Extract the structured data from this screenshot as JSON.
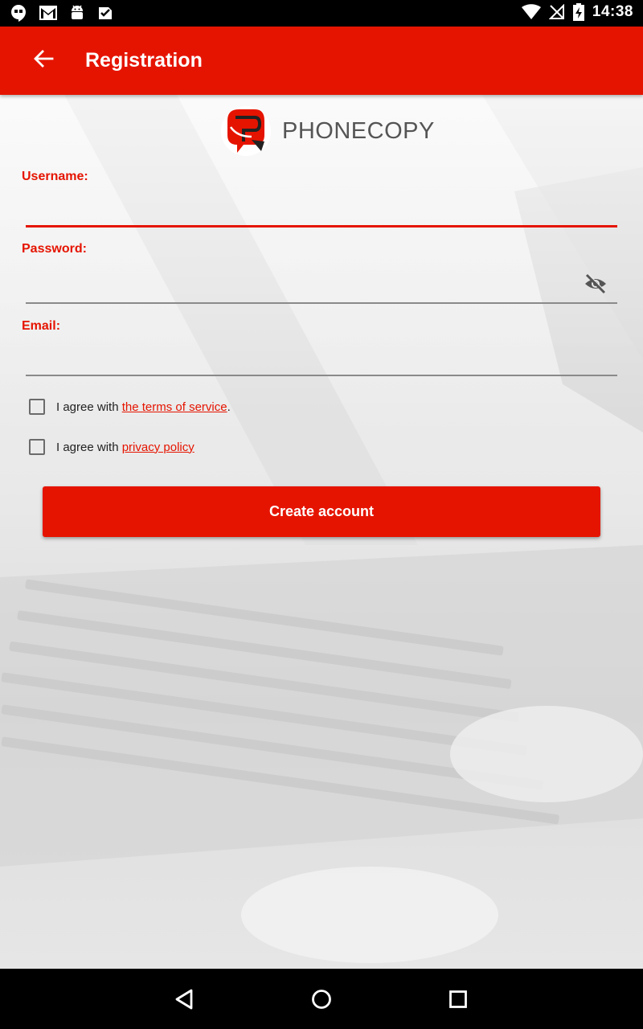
{
  "status_bar": {
    "time": "14:38",
    "left_icons": [
      "hangouts-icon",
      "gmail-icon",
      "android-icon",
      "download-check-icon"
    ],
    "right_icons": [
      "wifi-icon",
      "no-signal-icon",
      "battery-charging-icon"
    ]
  },
  "app_bar": {
    "title": "Registration",
    "back_icon": "arrow-back-icon"
  },
  "logo": {
    "text": "PHONECOPY"
  },
  "form": {
    "username_label": "Username:",
    "username_value": "",
    "password_label": "Password:",
    "password_value": "",
    "email_label": "Email:",
    "email_value": "",
    "terms": {
      "prefix": "I agree with ",
      "link": "the terms of service",
      "suffix": ".",
      "checked": false
    },
    "privacy": {
      "prefix": "I agree with ",
      "link": "privacy policy",
      "checked": false
    },
    "submit_label": "Create account"
  },
  "colors": {
    "accent": "#e51400",
    "status_bar": "#000000",
    "label_text": "#e51400"
  },
  "nav_bar": {
    "icons": [
      "back-triangle-icon",
      "home-circle-icon",
      "recents-square-icon"
    ]
  }
}
